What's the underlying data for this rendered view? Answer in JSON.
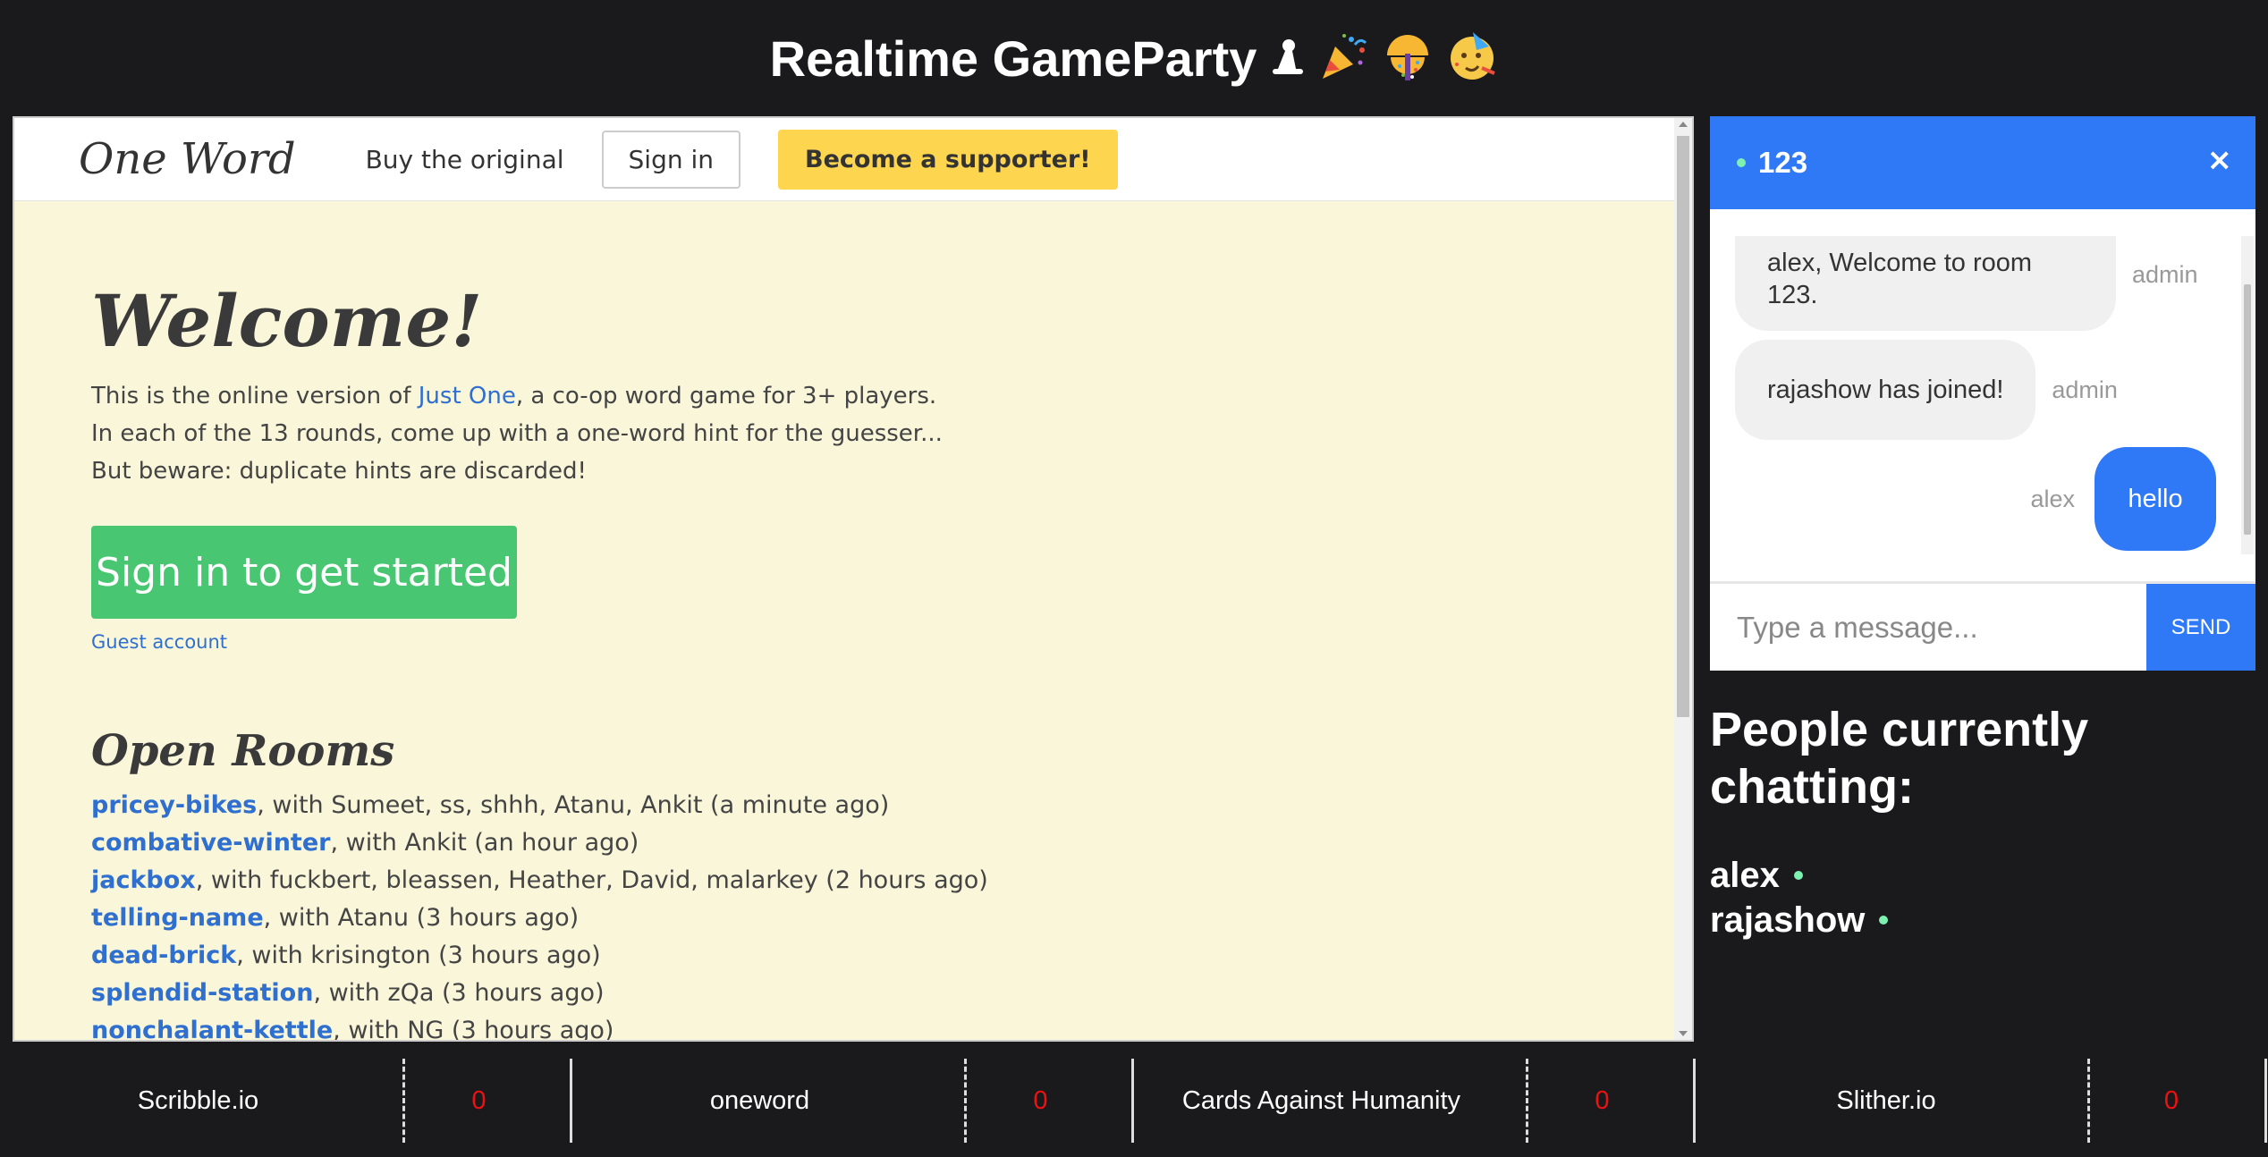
{
  "header": {
    "title": "Realtime GameParty"
  },
  "game": {
    "logo": "One Word",
    "nav": {
      "buy": "Buy the original",
      "signin": "Sign in",
      "support": "Become a supporter!"
    },
    "welcome": "Welcome!",
    "intro": {
      "line1_pre": "This is the online version of ",
      "line1_link": "Just One",
      "line1_post": ", a co-op word game for 3+ players.",
      "line2": "In each of the 13 rounds, come up with a one-word hint for the guesser...",
      "line3": "But beware: duplicate hints are discarded!"
    },
    "cta": "Sign in to get started",
    "guest": "Guest account",
    "rooms_heading": "Open Rooms",
    "rooms": [
      {
        "name": "pricey-bikes",
        "detail": ", with Sumeet, ss, shhh, Atanu, Ankit (a minute ago)"
      },
      {
        "name": "combative-winter",
        "detail": ", with Ankit (an hour ago)"
      },
      {
        "name": "jackbox",
        "detail": ", with fuckbert, bleassen, Heather, David, malarkey (2 hours ago)"
      },
      {
        "name": "telling-name",
        "detail": ", with Atanu (3 hours ago)"
      },
      {
        "name": "dead-brick",
        "detail": ", with krisington (3 hours ago)"
      },
      {
        "name": "splendid-station",
        "detail": ", with zQa (3 hours ago)"
      },
      {
        "name": "nonchalant-kettle",
        "detail": ", with NG (3 hours ago)"
      }
    ]
  },
  "chat": {
    "room": "123",
    "close": "×",
    "messages": [
      {
        "text": "alex, Welcome to room 123.",
        "sender": "admin"
      },
      {
        "text": "rajashow has joined!",
        "sender": "admin"
      },
      {
        "text": "hello",
        "sender": "alex"
      }
    ],
    "input_placeholder": "Type a message...",
    "send": "SEND"
  },
  "people": {
    "heading": "People currently chatting:",
    "list": [
      "alex",
      "rajashow"
    ]
  },
  "bottom_tabs": [
    {
      "name": "Scribble.io",
      "count": "0"
    },
    {
      "name": "oneword",
      "count": "0"
    },
    {
      "name": "Cards Against Humanity",
      "count": "0"
    },
    {
      "name": "Slither.io",
      "count": "0"
    }
  ],
  "colors": {
    "accent_blue": "#2f79f6",
    "cta_green": "#48c671",
    "supporter_yellow": "#fdd54f",
    "online_dot": "#7ef0b0",
    "count_red": "#e11111"
  },
  "icons": [
    "game-piece-icon",
    "party-popper-icon",
    "confetti-ball-icon",
    "party-face-icon"
  ]
}
